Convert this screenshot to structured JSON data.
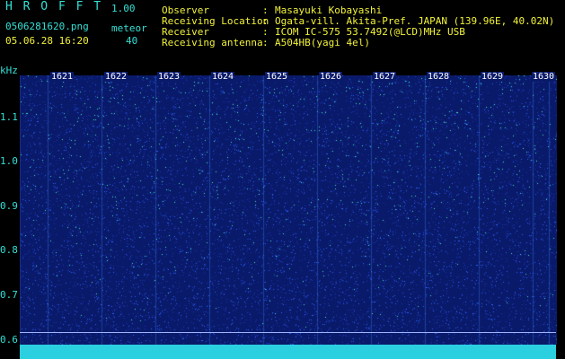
{
  "header": {
    "logo": "H R O F F T",
    "version": "1.00",
    "filename": "0506281620.png",
    "datetime": "05.06.28 16:20",
    "meteor_label": "meteor",
    "meteor_count": "40",
    "info": [
      {
        "label": "Observer",
        "value": "Masayuki Kobayashi"
      },
      {
        "label": "Receiving Location",
        "value": "Ogata-vill. Akita-Pref. JAPAN (139.96E, 40.02N)"
      },
      {
        "label": "Receiver",
        "value": "ICOM IC-575 53.7492(@LCD)MHz USB"
      },
      {
        "label": "Receiving antenna",
        "value": "A504HB(yagi 4el)"
      }
    ]
  },
  "axis": {
    "unit": "kHz",
    "ticks": [
      "1.1",
      "1.0",
      "0.9",
      "0.8",
      "0.7",
      "0.6"
    ]
  },
  "minutes": [
    "1621",
    "1622",
    "1623",
    "1624",
    "1625",
    "1626",
    "1627",
    "1628",
    "1629",
    "1630"
  ],
  "colors": {
    "background": "#000000",
    "spectrum": "#0a1a6a",
    "text": "#35e0d6",
    "highlight": "#f2f23a"
  }
}
